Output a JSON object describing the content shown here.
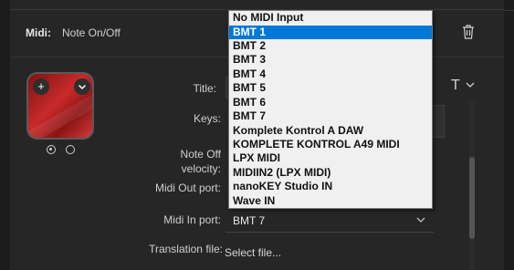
{
  "header": {
    "midi_label": "Midi:",
    "event_type": "Note On/Off"
  },
  "icon_tile": {
    "add_symbol": "+",
    "chevron_symbol": "⌄"
  },
  "form": {
    "title_label": "Title:",
    "keys_label": "Keys:",
    "note_off_label_line1": "Note Off",
    "note_off_label_line2": "velocity:",
    "midi_out_label": "Midi Out port:",
    "midi_in_label": "Midi In port:",
    "midi_in_value": "BMT 7",
    "translation_label": "Translation file:",
    "translation_value": "Select file...",
    "title_style_symbol": "T"
  },
  "dropdown": {
    "selected": "BMT 1",
    "options": [
      "No MIDI Input",
      "BMT 1",
      "BMT 2",
      "BMT 3",
      "BMT 4",
      "BMT 5",
      "BMT 6",
      "BMT 7",
      "Komplete Kontrol A DAW",
      "KOMPLETE KONTROL A49 MIDI",
      "LPX MIDI",
      "MIDIIN2 (LPX MIDI)",
      "nanoKEY Studio IN",
      "Wave IN"
    ]
  },
  "colors": {
    "accent": "#0078d7",
    "tile_red": "#c92a2a",
    "panel": "#262626"
  }
}
